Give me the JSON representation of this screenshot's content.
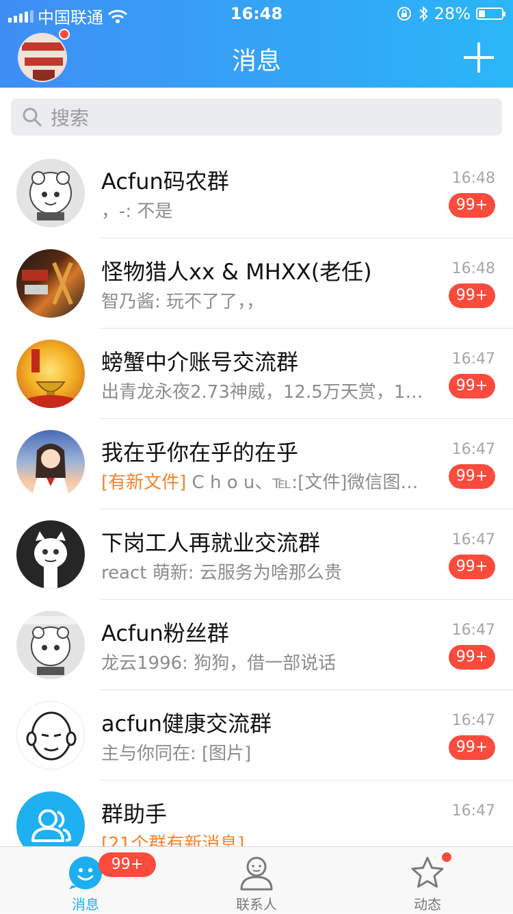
{
  "status_bar": {
    "carrier": "中国联通",
    "time": "16:48",
    "battery": "28%",
    "battery_level": 0.28,
    "icons": [
      "signal-icon",
      "wifi-icon",
      "orientation-lock-icon",
      "bluetooth-icon",
      "battery-icon"
    ]
  },
  "header": {
    "title": "消息",
    "profile_has_notification": true,
    "add_icon": "plus-icon"
  },
  "search": {
    "placeholder": "搜索",
    "icon": "search-icon"
  },
  "conversations": [
    {
      "name": "Acfun码农群",
      "preview": "，-: 不是",
      "time": "16:48",
      "badge": "99+"
    },
    {
      "name": "怪物猎人xx & MHXX(老任)",
      "preview": "智乃酱: 玩不了了，，",
      "time": "16:48",
      "badge": "99+"
    },
    {
      "name": "螃蟹中介账号交流群",
      "preview": "出青龙永夜2.73神威，12.5万天赏，10…",
      "time": "16:47",
      "badge": "99+"
    },
    {
      "name": "我在乎你在乎的在乎",
      "preview_tag": "[有新文件]",
      "preview": " C h o u、℡:[文件]微信图…",
      "time": "16:47",
      "badge": "99+"
    },
    {
      "name": "下岗工人再就业交流群",
      "preview": "react 萌新: 云服务为啥那么贵",
      "time": "16:47",
      "badge": "99+"
    },
    {
      "name": "Acfun粉丝群",
      "preview": "龙云1996: 狗狗，借一部说话",
      "time": "16:47",
      "badge": "99+"
    },
    {
      "name": "acfun健康交流群",
      "preview": "主与你同在: [图片]",
      "time": "16:47",
      "badge": "99+"
    },
    {
      "name": "群助手",
      "preview_tag": "[21个群有新消息]",
      "preview": "",
      "time": "16:47"
    }
  ],
  "tabs": [
    {
      "label": "消息",
      "icon": "message-smiley-icon",
      "badge": "99+",
      "active": true
    },
    {
      "label": "联系人",
      "icon": "contacts-person-icon",
      "active": false
    },
    {
      "label": "动态",
      "icon": "star-icon",
      "has_dot": true,
      "active": false
    }
  ],
  "colors": {
    "header_gradient_start": "#3f8ef5",
    "header_gradient_end": "#2ab6f7",
    "badge_red": "#fa4b3c",
    "accent_blue": "#1eaef0",
    "tag_orange": "#f7822a"
  }
}
